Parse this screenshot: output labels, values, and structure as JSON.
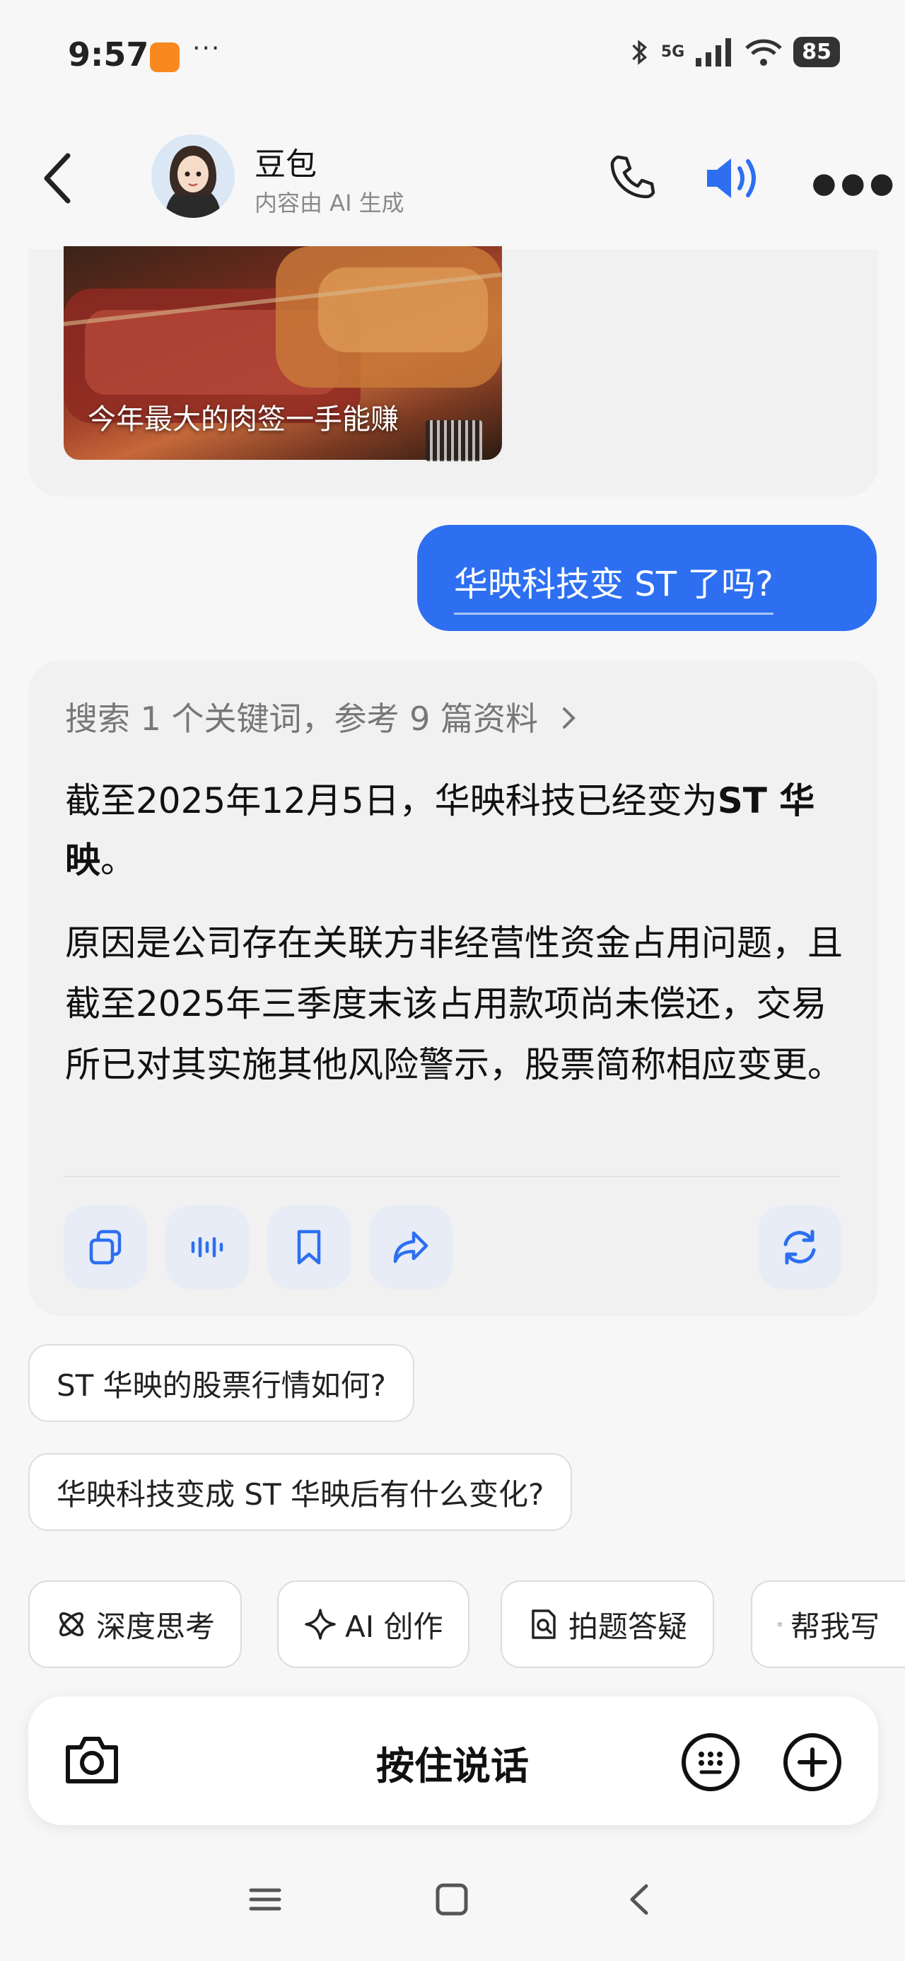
{
  "status": {
    "time": "9:57",
    "more": "···",
    "network": "5G",
    "battery": "85"
  },
  "header": {
    "title": "豆包",
    "subtitle": "内容由 AI 生成"
  },
  "image_card": {
    "caption": "今年最大的肉签一手能赚"
  },
  "user_message": "华映科技变 ST 了吗?",
  "answer": {
    "search_summary": "搜索 1 个关键词，参考 9 篇资料",
    "para1_prefix": "截至2025年12月5日，华映科技已经变为",
    "para1_bold": "ST 华映",
    "para1_suffix": "。",
    "para2": "原因是公司存在关联方非经营性资金占用问题，且截至2025年三季度末该占用款项尚未偿还，交易所已对其实施其他风险警示，股票简称相应变更。"
  },
  "suggestions": [
    "ST 华映的股票行情如何?",
    "华映科技变成 ST 华映后有什么变化?"
  ],
  "tools": [
    "深度思考",
    "AI 创作",
    "拍题答疑",
    "帮我写"
  ],
  "input": {
    "hold_to_talk": "按住说话"
  },
  "colors": {
    "accent": "#2d6ff0",
    "card": "#f1f1f2",
    "chip_border": "#dedede"
  }
}
